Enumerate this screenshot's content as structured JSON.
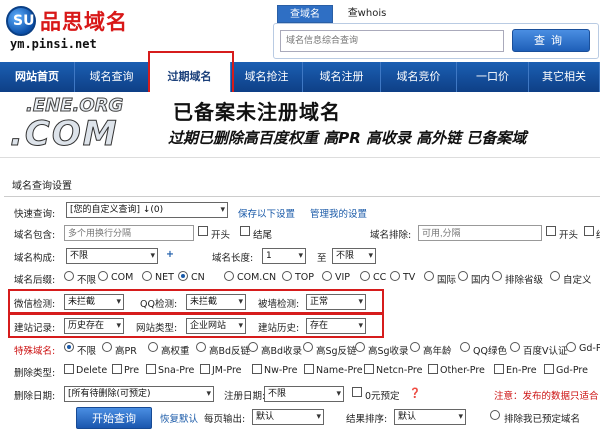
{
  "logo": {
    "mark": "SU",
    "name_cn": "品思域名",
    "domain": "ym.pinsi.net"
  },
  "search": {
    "tabs": [
      "查域名",
      "查whois"
    ],
    "placeholder": "域名信息综合查询",
    "button": "查询"
  },
  "nav": {
    "items": [
      "网站首页",
      "域名查询",
      "过期域名",
      "域名抢注",
      "域名注册",
      "域名竞价",
      "一口价",
      "其它相关"
    ],
    "active_index": 2
  },
  "banner": {
    "logo_text_top": ".ENE.ORG",
    "logo_text_main": ".COM",
    "headline": "已备案未注册域名",
    "subline": "过期已删除高百度权重 高PR 高收录 高外链 已备案域"
  },
  "section_title": "域名查询设置",
  "form": {
    "quick": {
      "label": "快速查询:",
      "value": "[您的自定义查询] ↓(0)",
      "save_link": "保存以下设置",
      "manage_link": "管理我的设置"
    },
    "contains": {
      "label": "域名包含:",
      "placeholder": "多个用换行分隔",
      "opt1": "开头",
      "opt2": "结尾",
      "exclude_label": "域名排除:",
      "exclude_placeholder": "可用,分隔",
      "opt3": "开头",
      "opt4": "结"
    },
    "compose": {
      "label": "域名构成:",
      "value": "不限",
      "len_label": "域名长度:",
      "len_min": "1",
      "to": "至",
      "len_max": "不限"
    },
    "suffix": {
      "label": "域名后缀:",
      "options": [
        "不限",
        "COM",
        "NET",
        "CN",
        "COM.CN",
        "TOP",
        "VIP",
        "CC",
        "TV",
        "国际",
        "国内",
        "排除省级",
        "自定义"
      ],
      "selected": "CN"
    },
    "wechat": {
      "label": "微信检测:",
      "value": "未拦截",
      "qq_label": "QQ检测:",
      "qq_value": "未拦截",
      "wall_label": "被墙检测:",
      "wall_value": "正常"
    },
    "build": {
      "label": "建站记录:",
      "value": "历史存在",
      "type_label": "网站类型:",
      "type_value": "企业网站",
      "history_label": "建站历史:",
      "history_value": "存在"
    },
    "special": {
      "label": "特殊域名:",
      "options": [
        "不限",
        "高PR",
        "高权重",
        "高Bd反链",
        "高Bd收录",
        "高Sg反链",
        "高Sg收录",
        "高年龄",
        "QQ绿色",
        "百度V认证",
        "Gd-Pre"
      ],
      "selected": "不限"
    },
    "delete_type": {
      "label": "删除类型:",
      "options": [
        "Delete",
        "Pre",
        "Sna-Pre",
        "JM-Pre",
        "Nw-Pre",
        "Name-Pre",
        "Netcn-Pre",
        "Other-Pre",
        "En-Pre",
        "Gd-Pre"
      ]
    },
    "delete_date": {
      "label": "删除日期:",
      "value": "[所有待删除(可预定)",
      "reg_label": "注册日期:",
      "reg_value": "不限",
      "price_label": "0元预定",
      "note": "注意：发布的数据只适合"
    },
    "bottom": {
      "start": "开始查询",
      "restore": "恢复默认",
      "per_page_label": "每页输出:",
      "per_page_value": "默认",
      "sort_label": "结果排序:",
      "sort_value": "默认",
      "exclude_reserved": "排除我已预定域名"
    }
  }
}
